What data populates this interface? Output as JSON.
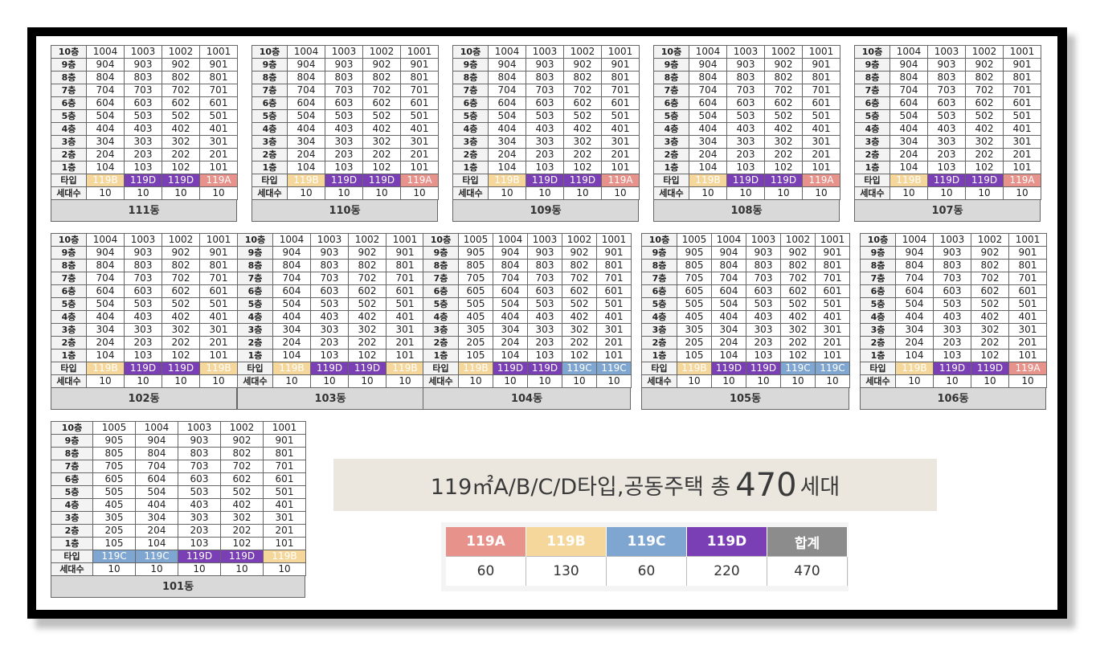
{
  "colors": {
    "119A": "#e8928c",
    "119B": "#f5d79b",
    "119C": "#7fa6d1",
    "119D": "#7a3fb5",
    "total": "#8c8c8c"
  },
  "labels": {
    "type": "타입",
    "households": "세대수"
  },
  "buildings": [
    {
      "name": "111동",
      "floors": [
        [
          "10층",
          "1004",
          "1003",
          "1002",
          "1001"
        ],
        [
          "9층",
          "904",
          "903",
          "902",
          "901"
        ],
        [
          "8층",
          "804",
          "803",
          "802",
          "801"
        ],
        [
          "7층",
          "704",
          "703",
          "702",
          "701"
        ],
        [
          "6층",
          "604",
          "603",
          "602",
          "601"
        ],
        [
          "5층",
          "504",
          "503",
          "502",
          "501"
        ],
        [
          "4층",
          "404",
          "403",
          "402",
          "401"
        ],
        [
          "3층",
          "304",
          "303",
          "302",
          "301"
        ],
        [
          "2층",
          "204",
          "203",
          "202",
          "201"
        ],
        [
          "1층",
          "104",
          "103",
          "102",
          "101"
        ]
      ],
      "types": [
        "119B",
        "119D",
        "119D",
        "119A"
      ],
      "households": [
        "10",
        "10",
        "10",
        "10"
      ]
    },
    {
      "name": "110동",
      "floors": [
        [
          "10층",
          "1004",
          "1003",
          "1002",
          "1001"
        ],
        [
          "9층",
          "904",
          "903",
          "902",
          "901"
        ],
        [
          "8층",
          "804",
          "803",
          "802",
          "801"
        ],
        [
          "7층",
          "704",
          "703",
          "702",
          "701"
        ],
        [
          "6층",
          "604",
          "603",
          "602",
          "601"
        ],
        [
          "5층",
          "504",
          "503",
          "502",
          "501"
        ],
        [
          "4층",
          "404",
          "403",
          "402",
          "401"
        ],
        [
          "3층",
          "304",
          "303",
          "302",
          "301"
        ],
        [
          "2층",
          "204",
          "203",
          "202",
          "201"
        ],
        [
          "1층",
          "104",
          "103",
          "102",
          "101"
        ]
      ],
      "types": [
        "119B",
        "119D",
        "119D",
        "119A"
      ],
      "households": [
        "10",
        "10",
        "10",
        "10"
      ]
    },
    {
      "name": "109동",
      "floors": [
        [
          "10층",
          "1004",
          "1003",
          "1002",
          "1001"
        ],
        [
          "9층",
          "904",
          "903",
          "902",
          "901"
        ],
        [
          "8층",
          "804",
          "803",
          "802",
          "801"
        ],
        [
          "7층",
          "704",
          "703",
          "702",
          "701"
        ],
        [
          "6층",
          "604",
          "603",
          "602",
          "601"
        ],
        [
          "5층",
          "504",
          "503",
          "502",
          "501"
        ],
        [
          "4층",
          "404",
          "403",
          "402",
          "401"
        ],
        [
          "3층",
          "304",
          "303",
          "302",
          "301"
        ],
        [
          "2층",
          "204",
          "203",
          "202",
          "201"
        ],
        [
          "1층",
          "104",
          "103",
          "102",
          "101"
        ]
      ],
      "types": [
        "119B",
        "119D",
        "119D",
        "119A"
      ],
      "households": [
        "10",
        "10",
        "10",
        "10"
      ]
    },
    {
      "name": "108동",
      "floors": [
        [
          "10층",
          "1004",
          "1003",
          "1002",
          "1001"
        ],
        [
          "9층",
          "904",
          "903",
          "902",
          "901"
        ],
        [
          "8층",
          "804",
          "803",
          "802",
          "801"
        ],
        [
          "7층",
          "704",
          "703",
          "702",
          "701"
        ],
        [
          "6층",
          "604",
          "603",
          "602",
          "601"
        ],
        [
          "5층",
          "504",
          "503",
          "502",
          "501"
        ],
        [
          "4층",
          "404",
          "403",
          "402",
          "401"
        ],
        [
          "3층",
          "304",
          "303",
          "302",
          "301"
        ],
        [
          "2층",
          "204",
          "203",
          "202",
          "201"
        ],
        [
          "1층",
          "104",
          "103",
          "102",
          "101"
        ]
      ],
      "types": [
        "119B",
        "119D",
        "119D",
        "119A"
      ],
      "households": [
        "10",
        "10",
        "10",
        "10"
      ]
    },
    {
      "name": "107동",
      "floors": [
        [
          "10층",
          "1004",
          "1003",
          "1002",
          "1001"
        ],
        [
          "9층",
          "904",
          "903",
          "902",
          "901"
        ],
        [
          "8층",
          "804",
          "803",
          "802",
          "801"
        ],
        [
          "7층",
          "704",
          "703",
          "702",
          "701"
        ],
        [
          "6층",
          "604",
          "603",
          "602",
          "601"
        ],
        [
          "5층",
          "504",
          "503",
          "502",
          "501"
        ],
        [
          "4층",
          "404",
          "403",
          "402",
          "401"
        ],
        [
          "3층",
          "304",
          "303",
          "302",
          "301"
        ],
        [
          "2층",
          "204",
          "203",
          "202",
          "201"
        ],
        [
          "1층",
          "104",
          "103",
          "102",
          "101"
        ]
      ],
      "types": [
        "119B",
        "119D",
        "119D",
        "119A"
      ],
      "households": [
        "10",
        "10",
        "10",
        "10"
      ]
    },
    {
      "name": "102동",
      "floors": [
        [
          "10층",
          "1004",
          "1003",
          "1002",
          "1001"
        ],
        [
          "9층",
          "904",
          "903",
          "902",
          "901"
        ],
        [
          "8층",
          "804",
          "803",
          "802",
          "801"
        ],
        [
          "7층",
          "704",
          "703",
          "702",
          "701"
        ],
        [
          "6층",
          "604",
          "603",
          "602",
          "601"
        ],
        [
          "5층",
          "504",
          "503",
          "502",
          "501"
        ],
        [
          "4층",
          "404",
          "403",
          "402",
          "401"
        ],
        [
          "3층",
          "304",
          "303",
          "302",
          "301"
        ],
        [
          "2층",
          "204",
          "203",
          "202",
          "201"
        ],
        [
          "1층",
          "104",
          "103",
          "102",
          "101"
        ]
      ],
      "types": [
        "119B",
        "119D",
        "119D",
        "119B"
      ],
      "households": [
        "10",
        "10",
        "10",
        "10"
      ]
    },
    {
      "name": "103동",
      "floors": [
        [
          "10층",
          "1004",
          "1003",
          "1002",
          "1001"
        ],
        [
          "9층",
          "904",
          "903",
          "902",
          "901"
        ],
        [
          "8층",
          "804",
          "803",
          "802",
          "801"
        ],
        [
          "7층",
          "704",
          "703",
          "702",
          "701"
        ],
        [
          "6층",
          "604",
          "603",
          "602",
          "601"
        ],
        [
          "5층",
          "504",
          "503",
          "502",
          "501"
        ],
        [
          "4층",
          "404",
          "403",
          "402",
          "401"
        ],
        [
          "3층",
          "304",
          "303",
          "302",
          "301"
        ],
        [
          "2층",
          "204",
          "203",
          "202",
          "201"
        ],
        [
          "1층",
          "104",
          "103",
          "102",
          "101"
        ]
      ],
      "types": [
        "119B",
        "119D",
        "119D",
        "119B"
      ],
      "households": [
        "10",
        "10",
        "10",
        "10"
      ]
    },
    {
      "name": "104동",
      "floors": [
        [
          "10층",
          "1005",
          "1004",
          "1003",
          "1002",
          "1001"
        ],
        [
          "9층",
          "905",
          "904",
          "903",
          "902",
          "901"
        ],
        [
          "8층",
          "805",
          "804",
          "803",
          "802",
          "801"
        ],
        [
          "7층",
          "705",
          "704",
          "703",
          "702",
          "701"
        ],
        [
          "6층",
          "605",
          "604",
          "603",
          "602",
          "601"
        ],
        [
          "5층",
          "505",
          "504",
          "503",
          "502",
          "501"
        ],
        [
          "4층",
          "405",
          "404",
          "403",
          "402",
          "401"
        ],
        [
          "3층",
          "305",
          "304",
          "303",
          "302",
          "301"
        ],
        [
          "2층",
          "205",
          "204",
          "203",
          "202",
          "201"
        ],
        [
          "1층",
          "105",
          "104",
          "103",
          "102",
          "101"
        ]
      ],
      "types": [
        "119B",
        "119D",
        "119D",
        "119C",
        "119C"
      ],
      "households": [
        "10",
        "10",
        "10",
        "10",
        "10"
      ]
    },
    {
      "name": "105동",
      "floors": [
        [
          "10층",
          "1005",
          "1004",
          "1003",
          "1002",
          "1001"
        ],
        [
          "9층",
          "905",
          "904",
          "903",
          "902",
          "901"
        ],
        [
          "8층",
          "805",
          "804",
          "803",
          "802",
          "801"
        ],
        [
          "7층",
          "705",
          "704",
          "703",
          "702",
          "701"
        ],
        [
          "6층",
          "605",
          "604",
          "603",
          "602",
          "601"
        ],
        [
          "5층",
          "505",
          "504",
          "503",
          "502",
          "501"
        ],
        [
          "4층",
          "405",
          "404",
          "403",
          "402",
          "401"
        ],
        [
          "3층",
          "305",
          "304",
          "303",
          "302",
          "301"
        ],
        [
          "2층",
          "205",
          "204",
          "203",
          "202",
          "201"
        ],
        [
          "1층",
          "105",
          "104",
          "103",
          "102",
          "101"
        ]
      ],
      "types": [
        "119B",
        "119D",
        "119D",
        "119C",
        "119C"
      ],
      "households": [
        "10",
        "10",
        "10",
        "10",
        "10"
      ]
    },
    {
      "name": "106동",
      "floors": [
        [
          "10층",
          "1004",
          "1003",
          "1002",
          "1001"
        ],
        [
          "9층",
          "904",
          "903",
          "902",
          "901"
        ],
        [
          "8층",
          "804",
          "803",
          "802",
          "801"
        ],
        [
          "7층",
          "704",
          "703",
          "702",
          "701"
        ],
        [
          "6층",
          "604",
          "603",
          "602",
          "601"
        ],
        [
          "5층",
          "504",
          "503",
          "502",
          "501"
        ],
        [
          "4층",
          "404",
          "403",
          "402",
          "401"
        ],
        [
          "3층",
          "304",
          "303",
          "302",
          "301"
        ],
        [
          "2층",
          "204",
          "203",
          "202",
          "201"
        ],
        [
          "1층",
          "104",
          "103",
          "102",
          "101"
        ]
      ],
      "types": [
        "119B",
        "119D",
        "119D",
        "119A"
      ],
      "households": [
        "10",
        "10",
        "10",
        "10"
      ]
    },
    {
      "name": "101동",
      "floors": [
        [
          "10층",
          "1005",
          "1004",
          "1003",
          "1002",
          "1001"
        ],
        [
          "9층",
          "905",
          "904",
          "903",
          "902",
          "901"
        ],
        [
          "8층",
          "805",
          "804",
          "803",
          "802",
          "801"
        ],
        [
          "7층",
          "705",
          "704",
          "703",
          "702",
          "701"
        ],
        [
          "6층",
          "605",
          "604",
          "603",
          "602",
          "601"
        ],
        [
          "5층",
          "505",
          "504",
          "503",
          "502",
          "501"
        ],
        [
          "4층",
          "405",
          "404",
          "403",
          "402",
          "401"
        ],
        [
          "3층",
          "305",
          "304",
          "303",
          "302",
          "301"
        ],
        [
          "2층",
          "205",
          "204",
          "203",
          "202",
          "201"
        ],
        [
          "1층",
          "105",
          "104",
          "103",
          "102",
          "101"
        ]
      ],
      "types": [
        "119C",
        "119C",
        "119D",
        "119D",
        "119B"
      ],
      "households": [
        "10",
        "10",
        "10",
        "10",
        "10"
      ]
    }
  ],
  "banner": {
    "prefix": "119㎡A/B/C/D타입,공동주택 총",
    "count": "470",
    "suffix": "세대"
  },
  "summary": {
    "headers": [
      {
        "label": "119A",
        "color": "#e8928c"
      },
      {
        "label": "119B",
        "color": "#f5d79b"
      },
      {
        "label": "119C",
        "color": "#7fa6d1"
      },
      {
        "label": "119D",
        "color": "#7a3fb5"
      },
      {
        "label": "합계",
        "color": "#8c8c8c"
      }
    ],
    "values": [
      "60",
      "130",
      "60",
      "220",
      "470"
    ]
  }
}
